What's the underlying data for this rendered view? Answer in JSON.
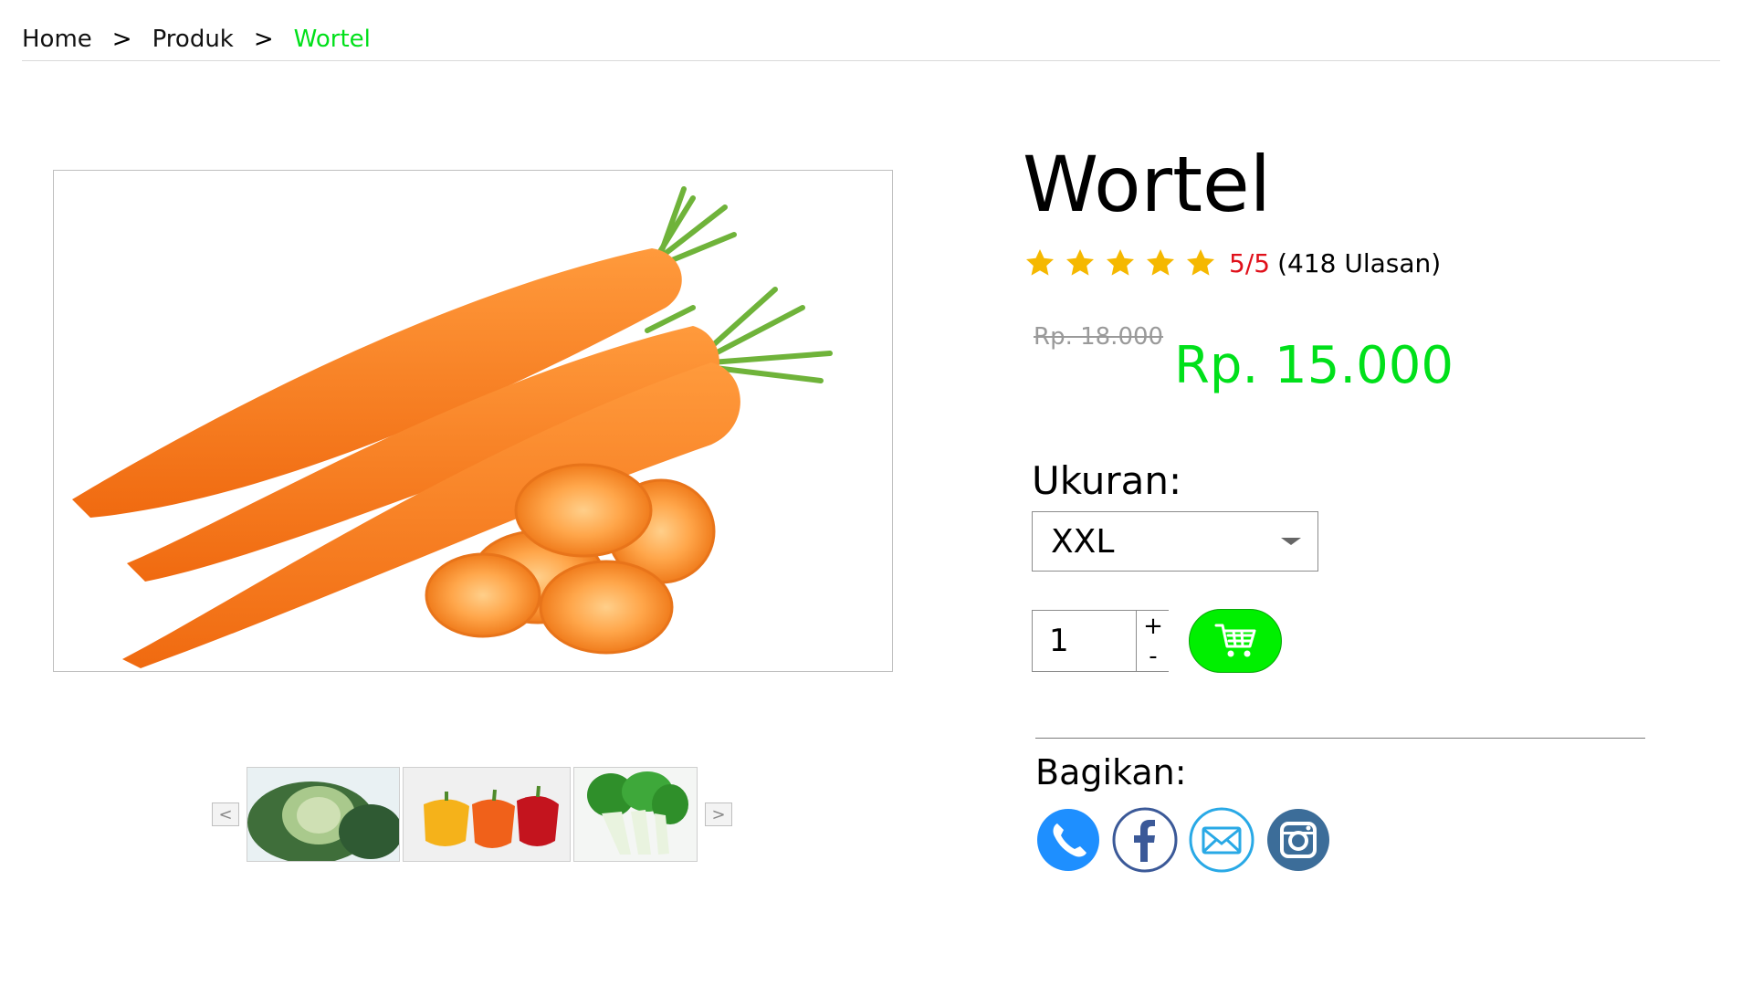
{
  "breadcrumb": {
    "home": "Home",
    "sep1": ">",
    "products": "Produk",
    "sep2": ">",
    "current": "Wortel"
  },
  "product": {
    "title": "Wortel",
    "rating": {
      "stars": 5,
      "score": "5/5",
      "count": "(418 Ulasan)"
    },
    "price_old": "Rp. 18.000",
    "price_new": "Rp. 15.000"
  },
  "size": {
    "label": "Ukuran:",
    "selected": "XXL"
  },
  "quantity": {
    "value": "1",
    "plus": "+",
    "minus": "-"
  },
  "thumbnails": {
    "prev": "<",
    "next": ">",
    "items": [
      "cabbage",
      "bell-peppers",
      "bok-choy"
    ]
  },
  "share": {
    "label": "Bagikan:",
    "icons": [
      "phone-icon",
      "facebook-icon",
      "mail-icon",
      "instagram-icon"
    ]
  },
  "colors": {
    "accent_green": "#00e01a",
    "cart_green": "#00f000",
    "rating_red": "#e0101a",
    "star_gold": "#f5b800"
  }
}
